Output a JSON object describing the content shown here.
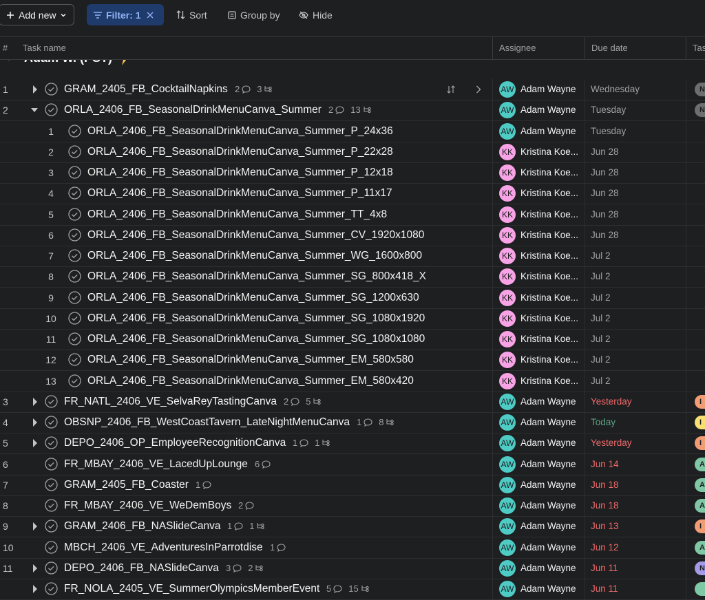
{
  "toolbar": {
    "add_new": "Add new",
    "filter": "Filter: 1",
    "sort": "Sort",
    "group_by": "Group by",
    "hide": "Hide"
  },
  "columns": {
    "num": "#",
    "task": "Task name",
    "assignee": "Assignee",
    "due": "Due date",
    "tags": "Tas"
  },
  "section": {
    "title": "Adam W. (PST)",
    "icon": "lightning-bolt-icon"
  },
  "colors": {
    "avatar_aw": "#4ecbc4",
    "avatar_kk": "#f8a3e6",
    "due_overdue": "#f06a6a",
    "due_today": "#5da283",
    "due_normal": "#a2a0a2"
  },
  "rows": [
    {
      "num": "1",
      "level": 0,
      "expander": "collapsed",
      "name": "GRAM_2405_FB_CocktailNapkins",
      "comments": "2",
      "subtasks": "3",
      "initials": "AW",
      "assignee": "Adam Wayne",
      "due": "Wednesday",
      "due_state": "normal",
      "tag": "N",
      "tag_color": "#6d6e6f",
      "show_row_icons": true
    },
    {
      "num": "2",
      "level": 0,
      "expander": "expanded",
      "name": "ORLA_2406_FB_SeasonalDrinkMenuCanva_Summer",
      "comments": "2",
      "subtasks": "13",
      "initials": "AW",
      "assignee": "Adam Wayne",
      "due": "Tuesday",
      "due_state": "normal",
      "tag": "N",
      "tag_color": "#6d6e6f"
    },
    {
      "num": "1",
      "level": 1,
      "name": "ORLA_2406_FB_SeasonalDrinkMenuCanva_Summer_P_24x36",
      "initials": "AW",
      "assignee": "Adam Wayne",
      "due": "Tuesday",
      "due_state": "normal"
    },
    {
      "num": "2",
      "level": 1,
      "name": "ORLA_2406_FB_SeasonalDrinkMenuCanva_Summer_P_22x28",
      "initials": "KK",
      "assignee": "Kristina Koe...",
      "due": "Jun 28",
      "due_state": "normal"
    },
    {
      "num": "3",
      "level": 1,
      "name": "ORLA_2406_FB_SeasonalDrinkMenuCanva_Summer_P_12x18",
      "initials": "KK",
      "assignee": "Kristina Koe...",
      "due": "Jun 28",
      "due_state": "normal"
    },
    {
      "num": "4",
      "level": 1,
      "name": "ORLA_2406_FB_SeasonalDrinkMenuCanva_Summer_P_11x17",
      "initials": "KK",
      "assignee": "Kristina Koe...",
      "due": "Jun 28",
      "due_state": "normal"
    },
    {
      "num": "5",
      "level": 1,
      "name": "ORLA_2406_FB_SeasonalDrinkMenuCanva_Summer_TT_4x8",
      "initials": "KK",
      "assignee": "Kristina Koe...",
      "due": "Jun 28",
      "due_state": "normal"
    },
    {
      "num": "6",
      "level": 1,
      "name": "ORLA_2406_FB_SeasonalDrinkMenuCanva_Summer_CV_1920x1080",
      "initials": "KK",
      "assignee": "Kristina Koe...",
      "due": "Jun 28",
      "due_state": "normal"
    },
    {
      "num": "7",
      "level": 1,
      "name": "ORLA_2406_FB_SeasonalDrinkMenuCanva_Summer_WG_1600x800",
      "initials": "KK",
      "assignee": "Kristina Koe...",
      "due": "Jul 2",
      "due_state": "normal"
    },
    {
      "num": "8",
      "level": 1,
      "name": "ORLA_2406_FB_SeasonalDrinkMenuCanva_Summer_SG_800x418_X",
      "initials": "KK",
      "assignee": "Kristina Koe...",
      "due": "Jul 2",
      "due_state": "normal"
    },
    {
      "num": "9",
      "level": 1,
      "name": "ORLA_2406_FB_SeasonalDrinkMenuCanva_Summer_SG_1200x630",
      "initials": "KK",
      "assignee": "Kristina Koe...",
      "due": "Jul 2",
      "due_state": "normal"
    },
    {
      "num": "10",
      "level": 1,
      "name": "ORLA_2406_FB_SeasonalDrinkMenuCanva_Summer_SG_1080x1920",
      "initials": "KK",
      "assignee": "Kristina Koe...",
      "due": "Jul 2",
      "due_state": "normal"
    },
    {
      "num": "11",
      "level": 1,
      "name": "ORLA_2406_FB_SeasonalDrinkMenuCanva_Summer_SG_1080x1080",
      "initials": "KK",
      "assignee": "Kristina Koe...",
      "due": "Jul 2",
      "due_state": "normal"
    },
    {
      "num": "12",
      "level": 1,
      "name": "ORLA_2406_FB_SeasonalDrinkMenuCanva_Summer_EM_580x580",
      "initials": "KK",
      "assignee": "Kristina Koe...",
      "due": "Jul 2",
      "due_state": "normal"
    },
    {
      "num": "13",
      "level": 1,
      "name": "ORLA_2406_FB_SeasonalDrinkMenuCanva_Summer_EM_580x420",
      "initials": "KK",
      "assignee": "Kristina Koe...",
      "due": "Jul 2",
      "due_state": "normal"
    },
    {
      "num": "3",
      "level": 0,
      "expander": "collapsed",
      "name": "FR_NATL_2406_VE_SelvaReyTastingCanva",
      "comments": "2",
      "subtasks": "5",
      "initials": "AW",
      "assignee": "Adam Wayne",
      "due": "Yesterday",
      "due_state": "overdue",
      "tag": "I",
      "tag_color": "#f19c73"
    },
    {
      "num": "4",
      "level": 0,
      "expander": "collapsed",
      "name": "OBSNP_2406_FB_WestCoastTavern_LateNightMenuCanva",
      "comments": "1",
      "subtasks": "8",
      "initials": "AW",
      "assignee": "Adam Wayne",
      "due": "Today",
      "due_state": "today",
      "tag": "I",
      "tag_color": "#f8df72"
    },
    {
      "num": "5",
      "level": 0,
      "expander": "collapsed",
      "name": "DEPO_2406_OP_EmployeeRecognitionCanva",
      "comments": "1",
      "subtasks": "1",
      "initials": "AW",
      "assignee": "Adam Wayne",
      "due": "Yesterday",
      "due_state": "overdue",
      "tag": "I",
      "tag_color": "#f19c73"
    },
    {
      "num": "6",
      "level": 0,
      "name": "FR_MBAY_2406_VE_LacedUpLounge",
      "comments": "6",
      "initials": "AW",
      "assignee": "Adam Wayne",
      "due": "Jun 14",
      "due_state": "overdue",
      "tag": "A",
      "tag_color": "#7fc8a5"
    },
    {
      "num": "7",
      "level": 0,
      "name": "GRAM_2405_FB_Coaster",
      "comments": "1",
      "initials": "AW",
      "assignee": "Adam Wayne",
      "due": "Jun 18",
      "due_state": "overdue",
      "tag": "A",
      "tag_color": "#7fc8a5"
    },
    {
      "num": "8",
      "level": 0,
      "name": "FR_MBAY_2406_VE_WeDemBoys",
      "comments": "2",
      "initials": "AW",
      "assignee": "Adam Wayne",
      "due": "Jun 18",
      "due_state": "overdue",
      "tag": "A",
      "tag_color": "#7fc8a5"
    },
    {
      "num": "9",
      "level": 0,
      "expander": "collapsed",
      "name": "GRAM_2406_FB_NASlideCanva",
      "comments": "1",
      "subtasks": "1",
      "initials": "AW",
      "assignee": "Adam Wayne",
      "due": "Jun 13",
      "due_state": "overdue",
      "tag": "I",
      "tag_color": "#f19c73"
    },
    {
      "num": "10",
      "level": 0,
      "name": "MBCH_2406_VE_AdventuresInParrotdise",
      "comments": "1",
      "initials": "AW",
      "assignee": "Adam Wayne",
      "due": "Jun 12",
      "due_state": "overdue",
      "tag": "A",
      "tag_color": "#7fc8a5"
    },
    {
      "num": "11",
      "level": 0,
      "expander": "collapsed",
      "name": "DEPO_2406_FB_NASlideCanva",
      "comments": "3",
      "subtasks": "2",
      "initials": "AW",
      "assignee": "Adam Wayne",
      "due": "Jun 11",
      "due_state": "overdue",
      "tag": "N",
      "tag_color": "#a49ae8"
    },
    {
      "num": "",
      "level": 0,
      "expander": "collapsed",
      "name": "FR_NOLA_2405_VE_SummerOlympicsMemberEvent",
      "comments": "5",
      "subtasks": "15",
      "initials": "AW",
      "assignee": "Adam Wayne",
      "due": "Jun 11",
      "due_state": "overdue",
      "tag": "",
      "tag_color": "#7fc8a5"
    }
  ]
}
